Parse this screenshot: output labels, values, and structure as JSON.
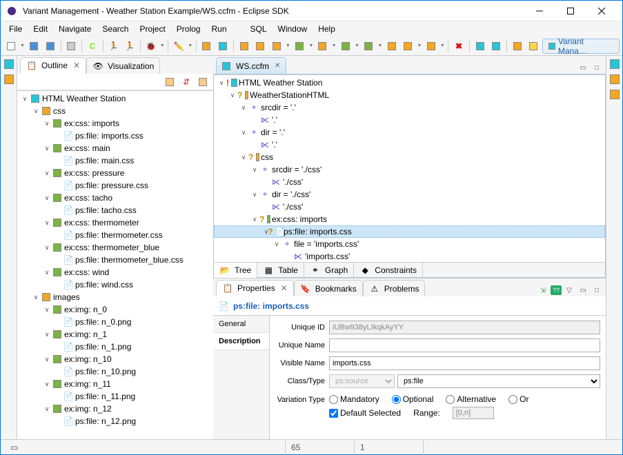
{
  "window": {
    "title": "Variant Management - Weather Station Example/WS.ccfm - Eclipse SDK"
  },
  "menu": [
    "File",
    "Edit",
    "Navigate",
    "Search",
    "Project",
    "Prolog",
    "Run",
    "",
    "SQL",
    "Window",
    "Help"
  ],
  "perspective": "Variant Mana…",
  "outline": {
    "tab_outline": "Outline",
    "tab_visualization": "Visualization",
    "root": "HTML Weather Station",
    "css": {
      "label": "css",
      "items": [
        {
          "name": "ex:css: imports",
          "file": "ps:file: imports.css"
        },
        {
          "name": "ex:css: main",
          "file": "ps:file: main.css"
        },
        {
          "name": "ex:css: pressure",
          "file": "ps:file: pressure.css"
        },
        {
          "name": "ex:css: tacho",
          "file": "ps:file: tacho.css"
        },
        {
          "name": "ex:css: thermometer",
          "file": "ps:file: thermometer.css"
        },
        {
          "name": "ex:css: thermometer_blue",
          "file": "ps:file: thermometer_blue.css"
        },
        {
          "name": "ex:css: wind",
          "file": "ps:file: wind.css"
        }
      ]
    },
    "images": {
      "label": "images",
      "items": [
        {
          "name": "ex:img: n_0",
          "file": "ps:file: n_0.png"
        },
        {
          "name": "ex:img: n_1",
          "file": "ps:file: n_1.png"
        },
        {
          "name": "ex:img: n_10",
          "file": "ps:file: n_10.png"
        },
        {
          "name": "ex:img: n_11",
          "file": "ps:file: n_11.png"
        },
        {
          "name": "ex:img: n_12",
          "file": "ps:file: n_12.png"
        }
      ]
    }
  },
  "editor": {
    "tab": "WS.ccfm",
    "tree": {
      "root": "HTML Weather Station",
      "ws": "WeatherStationHTML",
      "srcdir": "srcdir = '.'",
      "srcdir_v": "'.'",
      "dir": "dir = '.'",
      "dir_v": "'.'",
      "css": "css",
      "css_srcdir": "srcdir = './css'",
      "css_srcdir_v": "'./css'",
      "css_dir": "dir = './css'",
      "css_dir_v": "'./css'",
      "imports": "ex:css: imports",
      "imports_file": "ps:file: imports.css",
      "file_attr": "file = 'imports.css'",
      "file_attr_v": "'imports.css'"
    },
    "bottom_tabs": [
      "Tree",
      "Table",
      "Graph",
      "Constraints"
    ]
  },
  "properties": {
    "tabs": [
      "Properties",
      "Bookmarks",
      "Problems"
    ],
    "title": "ps:file: imports.css",
    "side_tabs": [
      "General",
      "Description"
    ],
    "unique_id_label": "Unique ID",
    "unique_id": "iUBw938yLIkqkAyYY",
    "unique_name_label": "Unique Name",
    "unique_name": "",
    "visible_name_label": "Visible Name",
    "visible_name": "imports.css",
    "class_type_label": "Class/Type",
    "class_type_1": "ps:source",
    "class_type_2": "ps:file",
    "variation_label": "Variation Type",
    "radio_mandatory": "Mandatory",
    "radio_optional": "Optional",
    "radio_alternative": "Alternative",
    "radio_or": "Or",
    "default_selected": "Default Selected",
    "range_label": "Range:",
    "range_value": "[0,n]"
  },
  "status": {
    "col1": "65",
    "col2": "1"
  }
}
